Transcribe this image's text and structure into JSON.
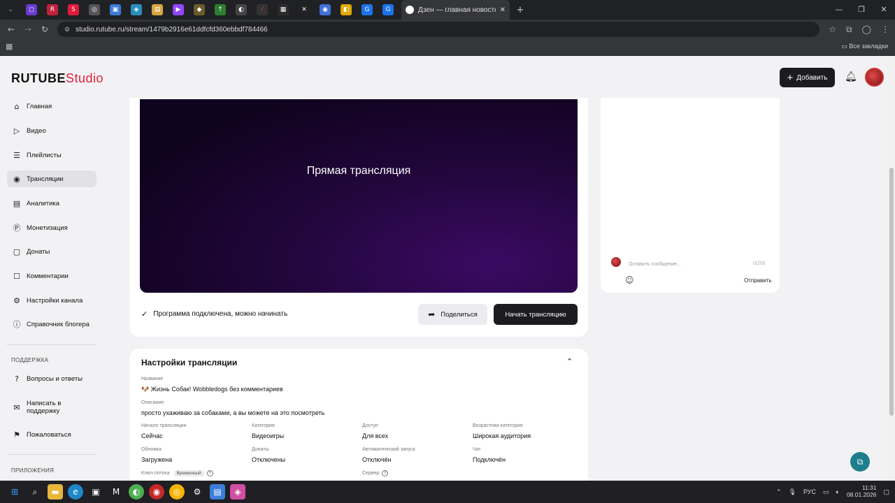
{
  "browser": {
    "active_tab_title": "Дзен — главная новостная и...",
    "url": "studio.rutube.ru/stream/1479b2916e61ddfcfd360ebbdf784466",
    "bookmarks_label": "Все закладки"
  },
  "header": {
    "logo_main": "RUTUBE",
    "logo_accent": "Studio",
    "add_label": "Добавить"
  },
  "sidebar": {
    "items": [
      {
        "label": "Главная",
        "icon": "home-icon"
      },
      {
        "label": "Видео",
        "icon": "video-icon"
      },
      {
        "label": "Плейлисты",
        "icon": "playlist-icon"
      },
      {
        "label": "Трансляции",
        "icon": "broadcast-icon"
      },
      {
        "label": "Аналитика",
        "icon": "analytics-icon"
      },
      {
        "label": "Монетизация",
        "icon": "monetization-icon"
      },
      {
        "label": "Донаты",
        "icon": "donate-icon"
      },
      {
        "label": "Комментарии",
        "icon": "comments-icon"
      },
      {
        "label": "Настройки канала",
        "icon": "settings-icon"
      },
      {
        "label": "Справочник блогера",
        "icon": "info-icon"
      }
    ],
    "support_label": "ПОДДЕРЖКА",
    "support_items": [
      {
        "label": "Вопросы и ответы",
        "icon": "question-icon"
      },
      {
        "label": "Написать в поддержку",
        "icon": "mail-icon"
      },
      {
        "label": "Пожаловаться",
        "icon": "flag-icon"
      }
    ],
    "apps_label": "ПРИЛОЖЕНИЯ"
  },
  "player": {
    "title": "Прямая трансляция",
    "status": "Программа подключена, можно начинать",
    "share_label": "Поделиться",
    "start_label": "Начать трансляцию"
  },
  "chat": {
    "placeholder": "Оставить сообщение...",
    "counter": "0/200",
    "send_label": "Отправить"
  },
  "settings": {
    "title": "Настройки трансляции",
    "name_label": "Название",
    "name_value": "🐶 Жизнь Собак! Wobbledogs без комментариев",
    "desc_label": "Описание",
    "desc_value": "просто ухаживаю за собаками, а вы можете на это посмотреть",
    "start_label": "Начало трансляции",
    "start_value": "Сейчас",
    "category_label": "Категория",
    "category_value": "Видеоигры",
    "access_label": "Доступ",
    "access_value": "Для всех",
    "age_label": "Возрастная категория",
    "age_value": "Широкая аудитория",
    "cover_label": "Обложка",
    "cover_value": "Загружена",
    "donates_label": "Донаты",
    "donates_value": "Отключены",
    "autostart_label": "Автоматический запуск",
    "autostart_value": "Отключён",
    "chat_label": "Чат",
    "chat_value": "Подключён",
    "key_label": "Ключ потока",
    "key_badge": "Временный",
    "server_label": "Сервер"
  },
  "taskbar": {
    "lang": "РУС",
    "time": "11:31",
    "date": "08.01.2026"
  }
}
